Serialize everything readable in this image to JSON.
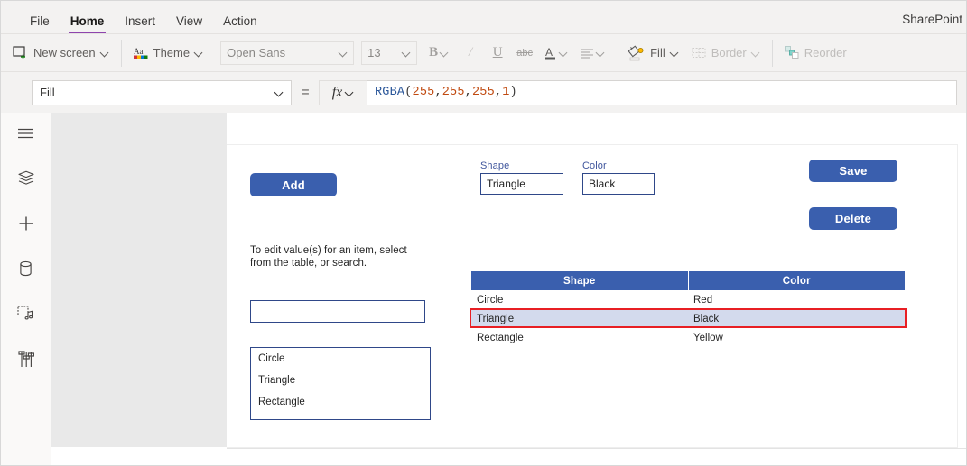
{
  "menubar": {
    "items": [
      {
        "label": "File",
        "active": false
      },
      {
        "label": "Home",
        "active": true
      },
      {
        "label": "Insert",
        "active": false
      },
      {
        "label": "View",
        "active": false
      },
      {
        "label": "Action",
        "active": false
      }
    ],
    "right_label": "SharePoint",
    "active_underline_color": "#8e44ad"
  },
  "ribbon": {
    "new_screen": {
      "label": "New screen",
      "icon": "new-screen-icon"
    },
    "theme": {
      "label": "Theme",
      "icon": "theme-icon"
    },
    "font_name": {
      "value": "Open Sans"
    },
    "font_size": {
      "value": "13"
    },
    "bold": "B",
    "italic": "I",
    "underline": "U",
    "strikethrough": "abc",
    "font_color": "A",
    "align": "align-icon",
    "fill": {
      "label": "Fill",
      "icon": "paint-bucket-icon"
    },
    "border": {
      "label": "Border",
      "icon": "border-icon"
    },
    "reorder": {
      "label": "Reorder",
      "icon": "reorder-icon"
    }
  },
  "formula_bar": {
    "property": "Fill",
    "equals": "=",
    "fx": "fx",
    "formula": {
      "function": "RGBA",
      "open": "(",
      "args": [
        "255",
        "255",
        "255",
        "1"
      ],
      "separator": ", ",
      "close": ")",
      "full_text": "RGBA(255, 255, 255, 1)"
    }
  },
  "sidebar": {
    "items": [
      {
        "name": "menu-icon",
        "title": "Menu"
      },
      {
        "name": "tree-view-icon",
        "title": "Tree view"
      },
      {
        "name": "insert-icon",
        "title": "Insert"
      },
      {
        "name": "data-icon",
        "title": "Data"
      },
      {
        "name": "media-icon",
        "title": "Media"
      },
      {
        "name": "advanced-icon",
        "title": "Advanced"
      }
    ]
  },
  "canvas": {
    "add_button": "Add",
    "save_button": "Save",
    "delete_button": "Delete",
    "helper_text_line1": "To edit value(s) for an item, select",
    "helper_text_line2": "from the table, or search.",
    "shape_field": {
      "label": "Shape",
      "value": "Triangle"
    },
    "color_field": {
      "label": "Color",
      "value": "Black"
    },
    "search_input": {
      "value": "",
      "placeholder": ""
    },
    "listbox": {
      "items": [
        "Circle",
        "Triangle",
        "Rectangle"
      ]
    },
    "table": {
      "columns": [
        "Shape",
        "Color"
      ],
      "rows": [
        {
          "shape": "Circle",
          "color": "Red",
          "selected": false
        },
        {
          "shape": "Triangle",
          "color": "Black",
          "selected": true
        },
        {
          "shape": "Rectangle",
          "color": "Yellow",
          "selected": false
        }
      ]
    },
    "colors": {
      "accent_blue": "#3a5fae",
      "selected_row": "#d3daed",
      "selection_outline": "#e81f24",
      "label_blue": "#40569d"
    }
  }
}
